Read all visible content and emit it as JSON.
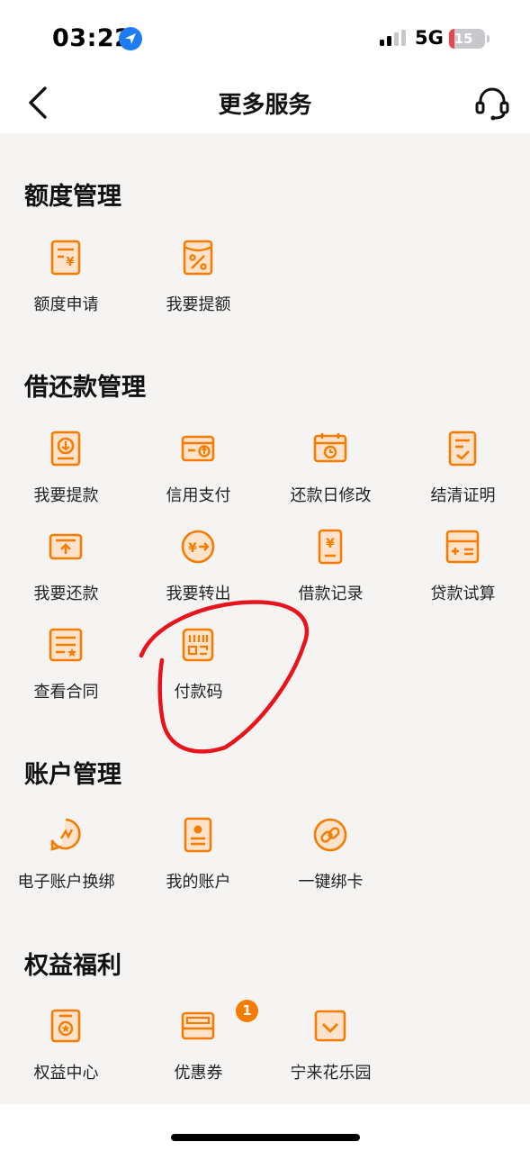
{
  "status_bar": {
    "time": "03:22",
    "network": "5G",
    "battery": "15"
  },
  "nav": {
    "title": "更多服务"
  },
  "sections": {
    "quota": {
      "title": "额度管理",
      "items": [
        {
          "label": "额度申请",
          "icon": "quota-apply-icon"
        },
        {
          "label": "我要提额",
          "icon": "raise-quota-icon"
        }
      ]
    },
    "loan": {
      "title": "借还款管理",
      "items": [
        {
          "label": "我要提款",
          "icon": "withdraw-icon"
        },
        {
          "label": "信用支付",
          "icon": "credit-pay-icon"
        },
        {
          "label": "还款日修改",
          "icon": "repay-date-icon"
        },
        {
          "label": "结清证明",
          "icon": "settlement-icon"
        },
        {
          "label": "我要还款",
          "icon": "repay-icon"
        },
        {
          "label": "我要转出",
          "icon": "transfer-out-icon"
        },
        {
          "label": "借款记录",
          "icon": "loan-record-icon"
        },
        {
          "label": "贷款试算",
          "icon": "loan-calculator-icon"
        },
        {
          "label": "查看合同",
          "icon": "contract-icon"
        },
        {
          "label": "付款码",
          "icon": "payment-code-icon"
        }
      ]
    },
    "account": {
      "title": "账户管理",
      "items": [
        {
          "label": "电子账户换绑",
          "icon": "rebind-account-icon"
        },
        {
          "label": "我的账户",
          "icon": "my-account-icon"
        },
        {
          "label": "一键绑卡",
          "icon": "bind-card-icon"
        }
      ]
    },
    "benefits": {
      "title": "权益福利",
      "items": [
        {
          "label": "权益中心",
          "icon": "benefit-center-icon"
        },
        {
          "label": "优惠券",
          "icon": "coupon-icon"
        },
        {
          "label": "宁来花乐园",
          "icon": "park-icon"
        }
      ],
      "coupon_badge": "1"
    }
  },
  "colors": {
    "accent": "#f57c00",
    "background": "#f5f4f2",
    "annotation": "#e8141c"
  }
}
